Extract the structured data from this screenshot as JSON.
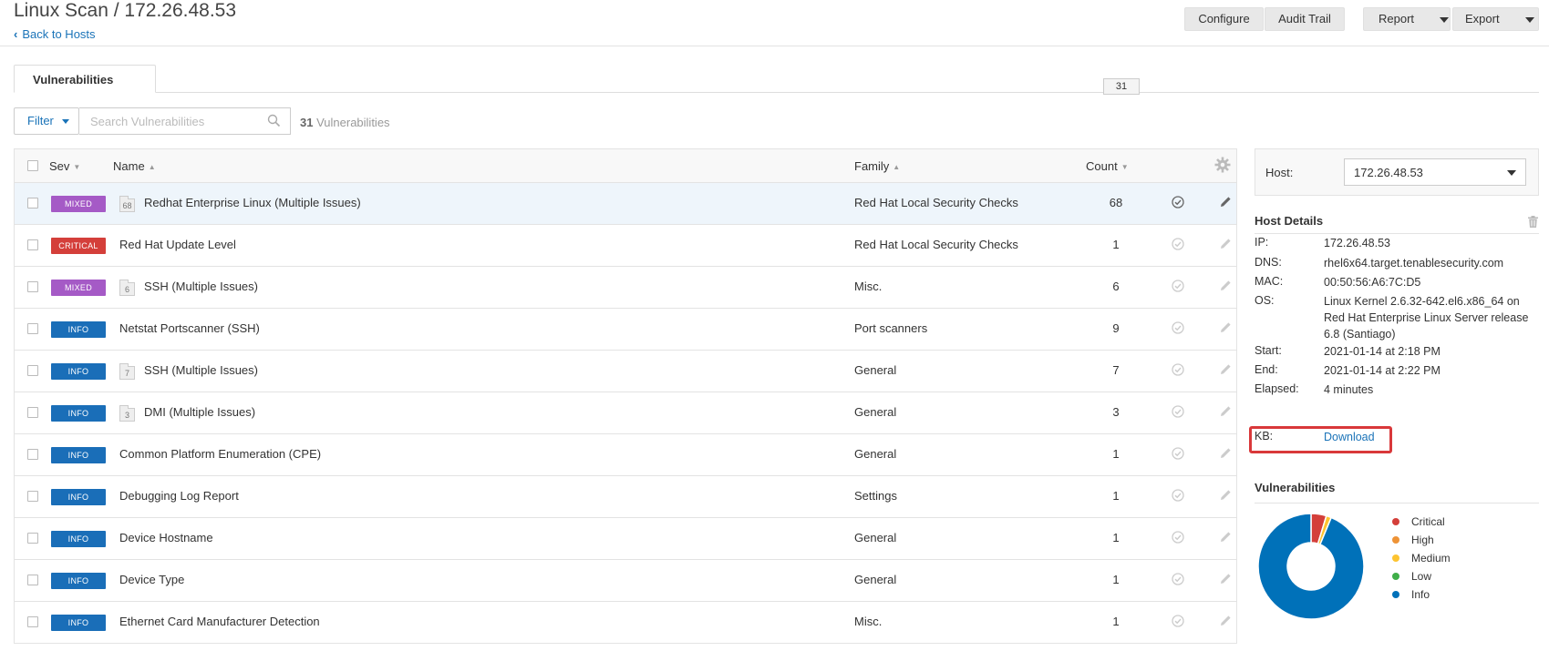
{
  "header": {
    "title": "Linux Scan / 172.26.48.53",
    "back_link": "Back to Hosts",
    "buttons": {
      "configure": "Configure",
      "audit_trail": "Audit Trail",
      "report": "Report",
      "export": "Export"
    }
  },
  "tabs": [
    {
      "label": "Vulnerabilities",
      "count": "31"
    }
  ],
  "filter": {
    "label": "Filter",
    "search_placeholder": "Search Vulnerabilities",
    "result_count": "31",
    "result_label": "Vulnerabilities"
  },
  "table": {
    "columns": {
      "sev": "Sev",
      "name": "Name",
      "family": "Family",
      "count": "Count"
    },
    "rows": [
      {
        "sev": "MIXED",
        "sev_class": "mixed",
        "group_count": "68",
        "name": "Redhat Enterprise Linux (Multiple Issues)",
        "family": "Red Hat Local Security Checks",
        "count": "68"
      },
      {
        "sev": "CRITICAL",
        "sev_class": "critical",
        "group_count": "",
        "name": "Red Hat Update Level",
        "family": "Red Hat Local Security Checks",
        "count": "1"
      },
      {
        "sev": "MIXED",
        "sev_class": "mixed",
        "group_count": "6",
        "name": "SSH (Multiple Issues)",
        "family": "Misc.",
        "count": "6"
      },
      {
        "sev": "INFO",
        "sev_class": "info",
        "group_count": "",
        "name": "Netstat Portscanner (SSH)",
        "family": "Port scanners",
        "count": "9"
      },
      {
        "sev": "INFO",
        "sev_class": "info",
        "group_count": "7",
        "name": "SSH (Multiple Issues)",
        "family": "General",
        "count": "7"
      },
      {
        "sev": "INFO",
        "sev_class": "info",
        "group_count": "3",
        "name": "DMI (Multiple Issues)",
        "family": "General",
        "count": "3"
      },
      {
        "sev": "INFO",
        "sev_class": "info",
        "group_count": "",
        "name": "Common Platform Enumeration (CPE)",
        "family": "General",
        "count": "1"
      },
      {
        "sev": "INFO",
        "sev_class": "info",
        "group_count": "",
        "name": "Debugging Log Report",
        "family": "Settings",
        "count": "1"
      },
      {
        "sev": "INFO",
        "sev_class": "info",
        "group_count": "",
        "name": "Device Hostname",
        "family": "General",
        "count": "1"
      },
      {
        "sev": "INFO",
        "sev_class": "info",
        "group_count": "",
        "name": "Device Type",
        "family": "General",
        "count": "1"
      },
      {
        "sev": "INFO",
        "sev_class": "info",
        "group_count": "",
        "name": "Ethernet Card Manufacturer Detection",
        "family": "Misc.",
        "count": "1"
      }
    ]
  },
  "host_panel": {
    "host_label": "Host:",
    "host_value": "172.26.48.53",
    "details_title": "Host Details",
    "details": [
      {
        "label": "IP:",
        "value": "172.26.48.53"
      },
      {
        "label": "DNS:",
        "value": "rhel6x64.target.tenablesecurity.com"
      },
      {
        "label": "MAC:",
        "value": "00:50:56:A6:7C:D5"
      },
      {
        "label": "OS:",
        "value": "Linux Kernel 2.6.32-642.el6.x86_64 on Red Hat Enterprise Linux Server release 6.8 (Santiago)"
      },
      {
        "label": "Start:",
        "value": "2021-01-14 at 2:18 PM"
      },
      {
        "label": "End:",
        "value": "2021-01-14 at 2:22 PM"
      },
      {
        "label": "Elapsed:",
        "value": "4 minutes"
      }
    ],
    "kb_label": "KB:",
    "kb_link": "Download",
    "vuln_title": "Vulnerabilities"
  },
  "chart_data": {
    "type": "pie",
    "categories": [
      "Critical",
      "High",
      "Medium",
      "Low",
      "Info"
    ],
    "values": [
      3,
      0,
      1,
      0,
      60
    ],
    "colors": [
      "#d43f3a",
      "#ee9336",
      "#fdc431",
      "#3fae49",
      "#0071b9"
    ],
    "legend_position": "right"
  }
}
